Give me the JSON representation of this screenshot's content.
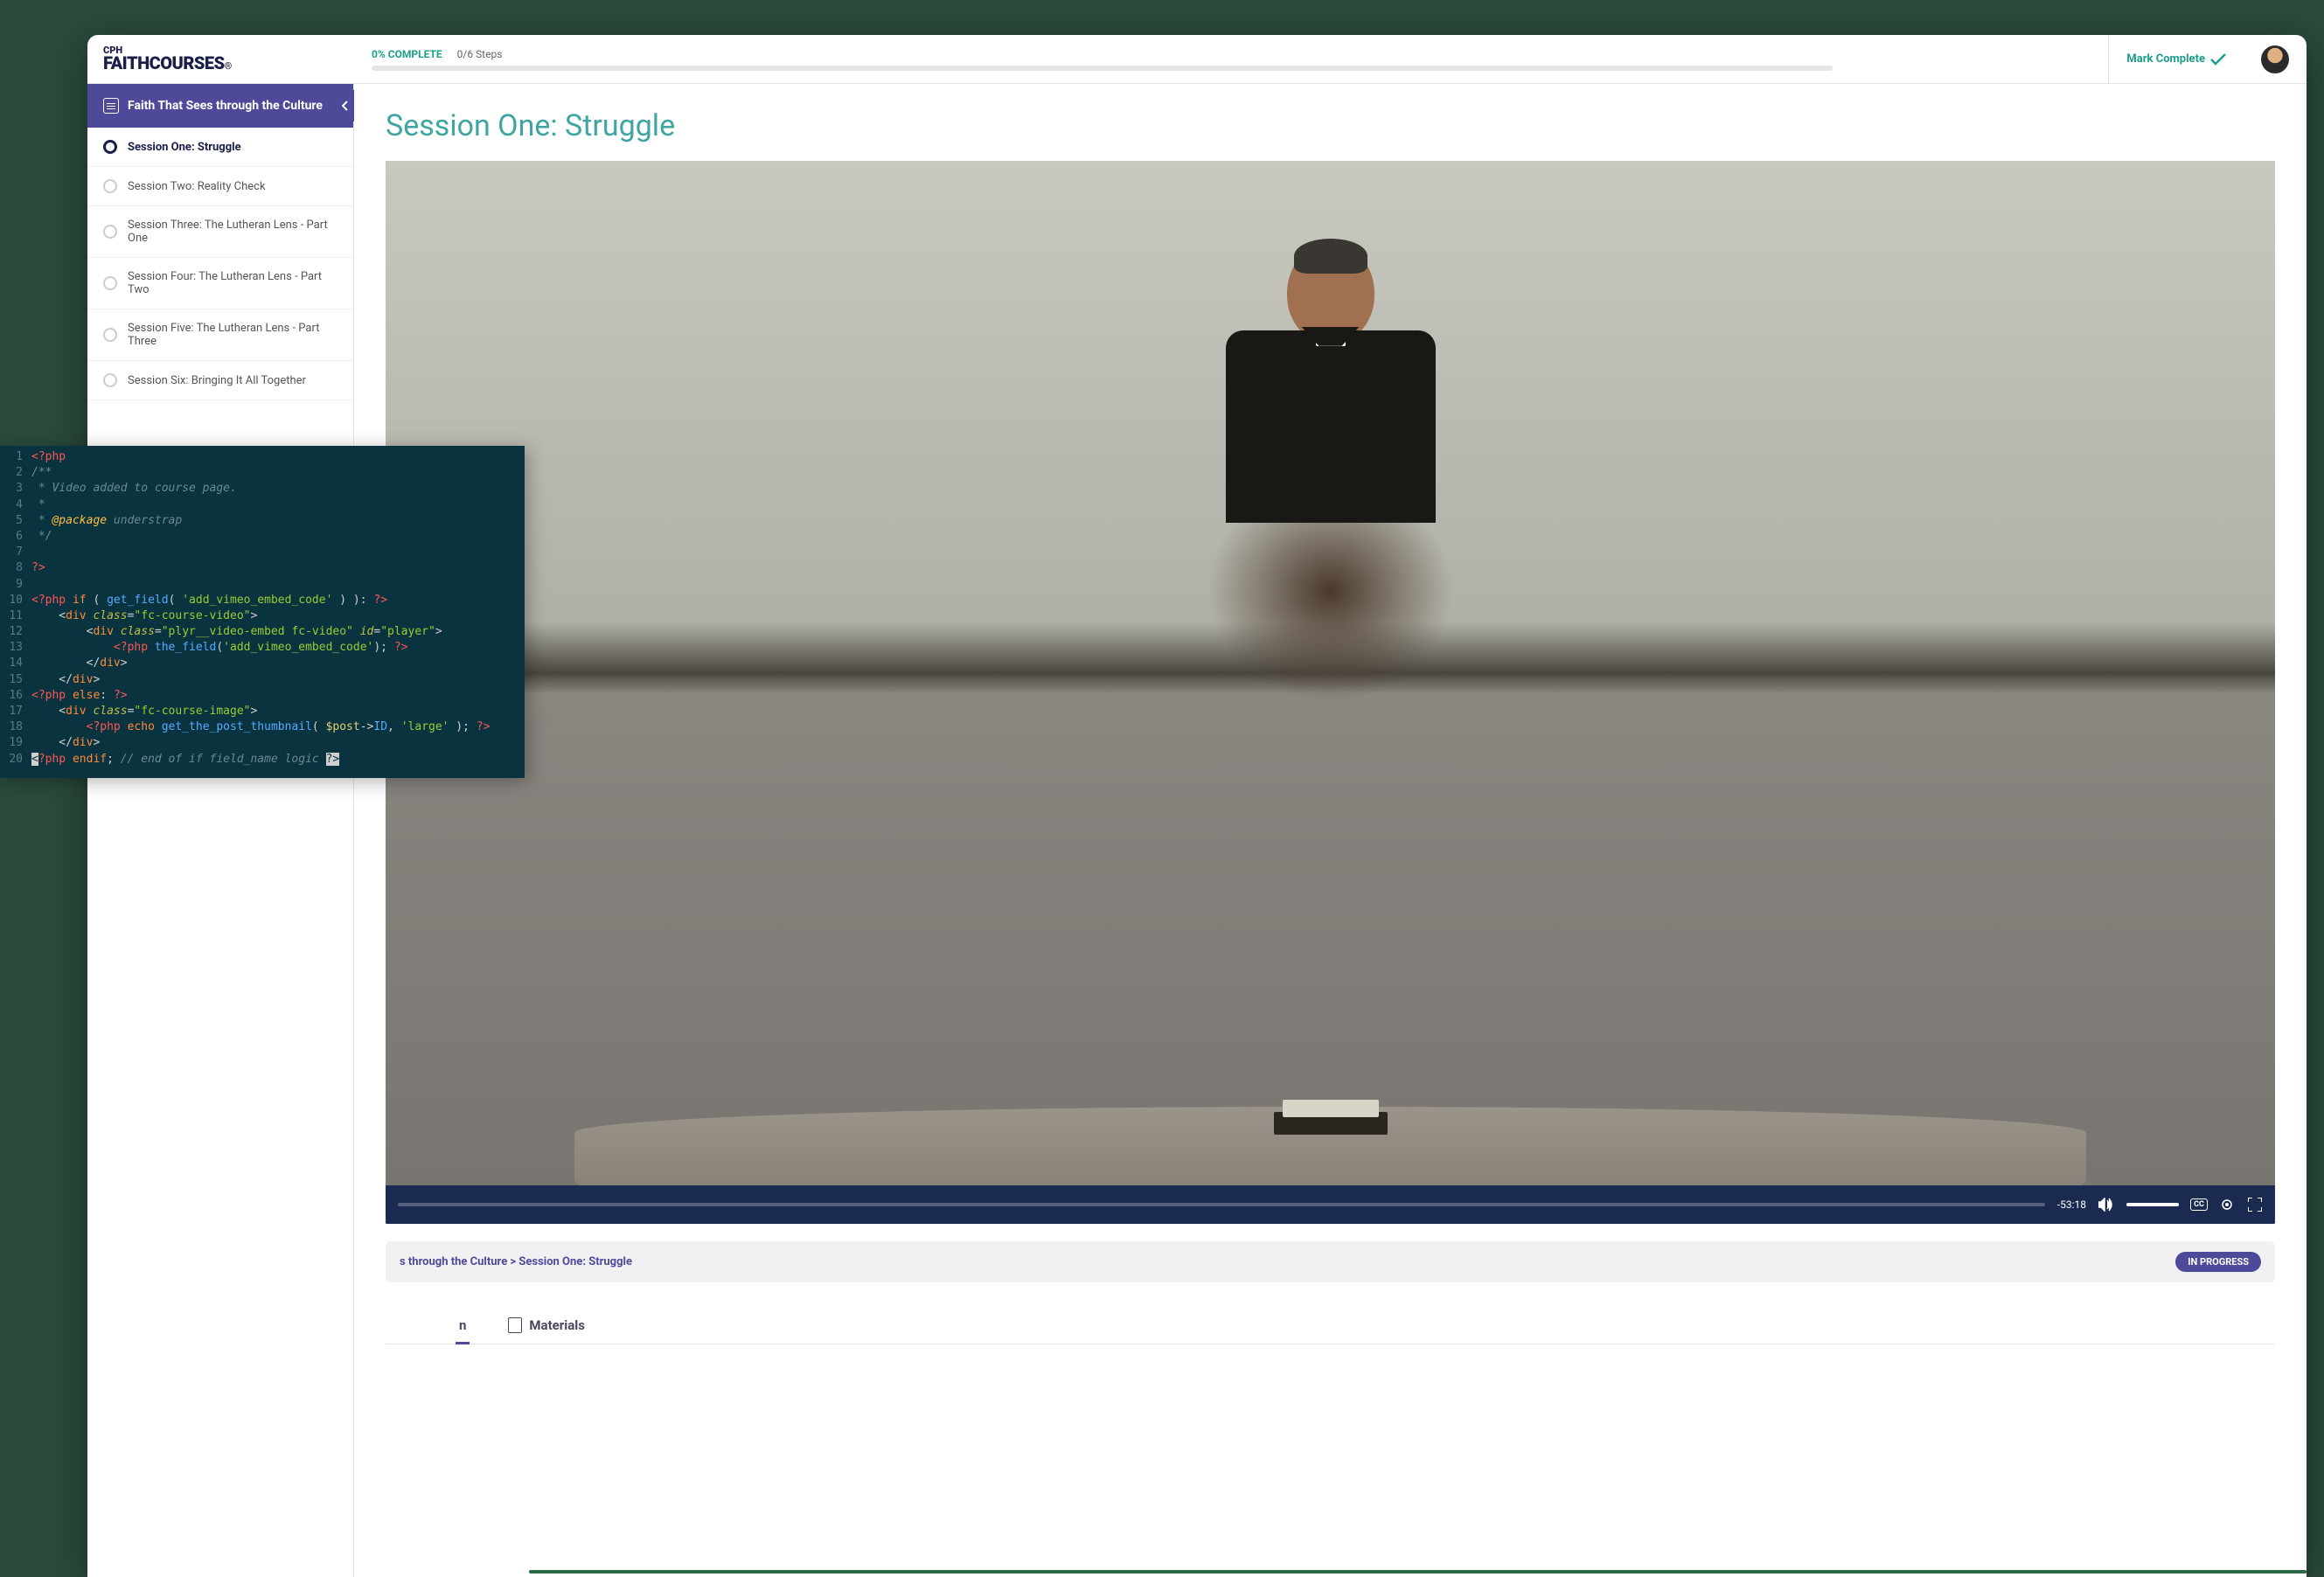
{
  "logo": {
    "top": "CPH",
    "bottom": "FAITHCOURSES",
    "mark": "®"
  },
  "progress": {
    "pct_label": "0% COMPLETE",
    "steps_label": "0/6 Steps"
  },
  "mark_complete": "Mark Complete",
  "course_title": "Faith That Sees through the Culture",
  "sessions": [
    "Session One: Struggle",
    "Session Two: Reality Check",
    "Session Three: The Lutheran Lens - Part One",
    "Session Four: The Lutheran Lens - Part Two",
    "Session Five: The Lutheran Lens - Part Three",
    "Session Six: Bringing It All Together"
  ],
  "page_title": "Session One: Struggle",
  "video": {
    "time": "-53:18"
  },
  "breadcrumb": "s through the Culture > Session One: Struggle",
  "badge": "IN PROGRESS",
  "tabs": {
    "lesson": "n",
    "materials": "Materials"
  },
  "code": {
    "lines": [
      [
        {
          "c": "t-tag",
          "t": "<?php"
        }
      ],
      [
        {
          "c": "t-comment",
          "t": "/**"
        }
      ],
      [
        {
          "c": "t-comment",
          "t": " * Video added to course page."
        }
      ],
      [
        {
          "c": "t-comment",
          "t": " *"
        }
      ],
      [
        {
          "c": "t-comment",
          "t": " * "
        },
        {
          "c": "t-doc",
          "t": "@package"
        },
        {
          "c": "t-comment",
          "t": " understrap"
        }
      ],
      [
        {
          "c": "t-comment",
          "t": " */"
        }
      ],
      [],
      [
        {
          "c": "t-tag",
          "t": "?>"
        }
      ],
      [],
      [
        {
          "c": "t-tag",
          "t": "<?php"
        },
        {
          "c": "t-plain",
          "t": " "
        },
        {
          "c": "t-kw",
          "t": "if"
        },
        {
          "c": "t-plain",
          "t": " ( "
        },
        {
          "c": "t-fn",
          "t": "get_field"
        },
        {
          "c": "t-plain",
          "t": "( "
        },
        {
          "c": "t-str",
          "t": "'add_vimeo_embed_code'"
        },
        {
          "c": "t-plain",
          "t": " ) ): "
        },
        {
          "c": "t-tag",
          "t": "?>"
        }
      ],
      [
        {
          "c": "t-plain",
          "t": "    <"
        },
        {
          "c": "t-kw",
          "t": "div"
        },
        {
          "c": "t-plain",
          "t": " "
        },
        {
          "c": "t-attr",
          "t": "class"
        },
        {
          "c": "t-plain",
          "t": "="
        },
        {
          "c": "t-str",
          "t": "\"fc-course-video\""
        },
        {
          "c": "t-plain",
          "t": ">"
        }
      ],
      [
        {
          "c": "t-plain",
          "t": "        <"
        },
        {
          "c": "t-kw",
          "t": "div"
        },
        {
          "c": "t-plain",
          "t": " "
        },
        {
          "c": "t-attr",
          "t": "class"
        },
        {
          "c": "t-plain",
          "t": "="
        },
        {
          "c": "t-str",
          "t": "\"plyr__video-embed fc-video\""
        },
        {
          "c": "t-plain",
          "t": " "
        },
        {
          "c": "t-attr",
          "t": "id"
        },
        {
          "c": "t-plain",
          "t": "="
        },
        {
          "c": "t-str",
          "t": "\"player\""
        },
        {
          "c": "t-plain",
          "t": ">"
        }
      ],
      [
        {
          "c": "t-plain",
          "t": "            "
        },
        {
          "c": "t-tag",
          "t": "<?php"
        },
        {
          "c": "t-plain",
          "t": " "
        },
        {
          "c": "t-fn",
          "t": "the_field"
        },
        {
          "c": "t-plain",
          "t": "("
        },
        {
          "c": "t-str",
          "t": "'add_vimeo_embed_code'"
        },
        {
          "c": "t-plain",
          "t": "); "
        },
        {
          "c": "t-tag",
          "t": "?>"
        }
      ],
      [
        {
          "c": "t-plain",
          "t": "        </"
        },
        {
          "c": "t-kw",
          "t": "div"
        },
        {
          "c": "t-plain",
          "t": ">"
        }
      ],
      [
        {
          "c": "t-plain",
          "t": "    </"
        },
        {
          "c": "t-kw",
          "t": "div"
        },
        {
          "c": "t-plain",
          "t": ">"
        }
      ],
      [
        {
          "c": "t-tag",
          "t": "<?php"
        },
        {
          "c": "t-plain",
          "t": " "
        },
        {
          "c": "t-kw",
          "t": "else"
        },
        {
          "c": "t-plain",
          "t": ": "
        },
        {
          "c": "t-tag",
          "t": "?>"
        }
      ],
      [
        {
          "c": "t-plain",
          "t": "    <"
        },
        {
          "c": "t-kw",
          "t": "div"
        },
        {
          "c": "t-plain",
          "t": " "
        },
        {
          "c": "t-attr",
          "t": "class"
        },
        {
          "c": "t-plain",
          "t": "="
        },
        {
          "c": "t-str",
          "t": "\"fc-course-image\""
        },
        {
          "c": "t-plain",
          "t": ">"
        }
      ],
      [
        {
          "c": "t-plain",
          "t": "        "
        },
        {
          "c": "t-tag",
          "t": "<?php"
        },
        {
          "c": "t-plain",
          "t": " "
        },
        {
          "c": "t-kw",
          "t": "echo"
        },
        {
          "c": "t-plain",
          "t": " "
        },
        {
          "c": "t-fn",
          "t": "get_the_post_thumbnail"
        },
        {
          "c": "t-plain",
          "t": "( "
        },
        {
          "c": "t-var",
          "t": "$post"
        },
        {
          "c": "t-plain",
          "t": "->"
        },
        {
          "c": "t-fn",
          "t": "ID"
        },
        {
          "c": "t-plain",
          "t": ", "
        },
        {
          "c": "t-str",
          "t": "'large'"
        },
        {
          "c": "t-plain",
          "t": " ); "
        },
        {
          "c": "t-tag",
          "t": "?>"
        }
      ],
      [
        {
          "c": "t-plain",
          "t": "    </"
        },
        {
          "c": "t-kw",
          "t": "div"
        },
        {
          "c": "t-plain",
          "t": ">"
        }
      ],
      [
        {
          "c": "cursor-hl",
          "t": "<"
        },
        {
          "c": "t-tag",
          "t": "?php"
        },
        {
          "c": "t-plain",
          "t": " "
        },
        {
          "c": "t-kw",
          "t": "endif"
        },
        {
          "c": "t-plain",
          "t": "; "
        },
        {
          "c": "t-comment",
          "t": "// end of if field_name logic "
        },
        {
          "c": "cursor-hl",
          "t": "?>"
        }
      ]
    ]
  }
}
